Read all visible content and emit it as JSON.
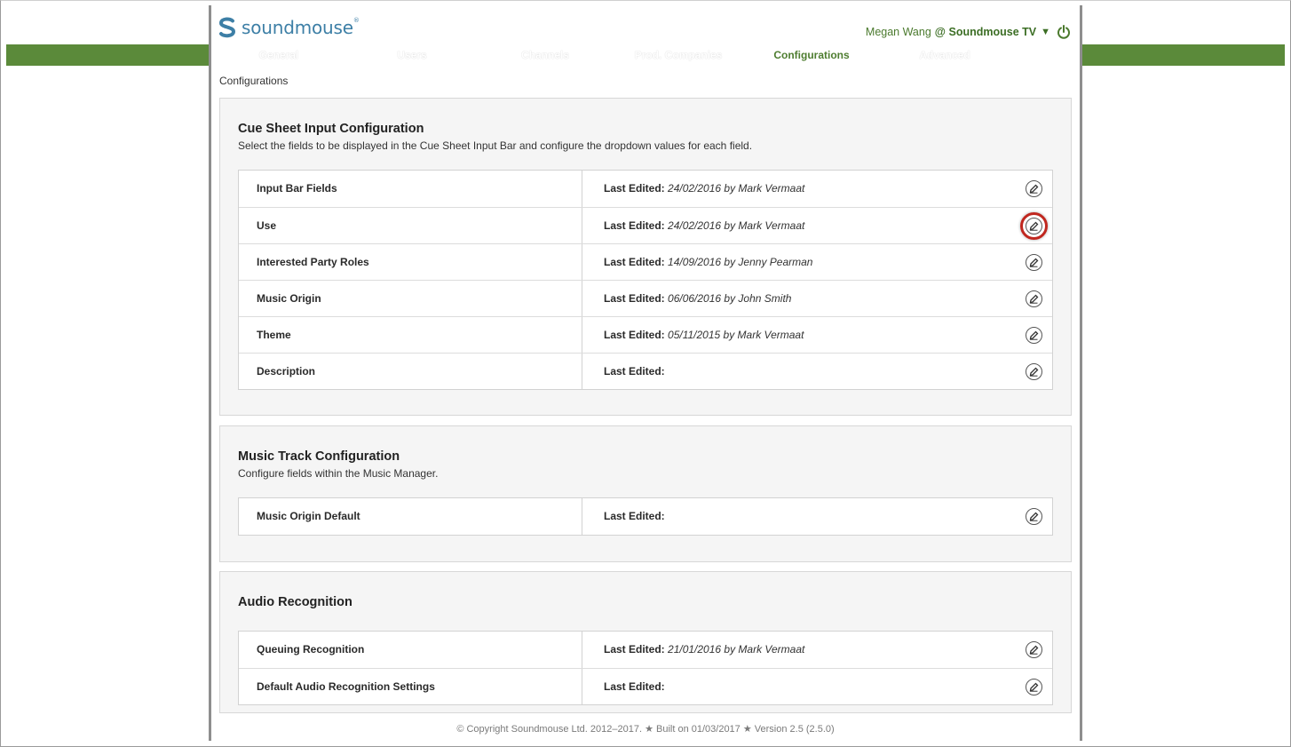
{
  "header": {
    "logo_text": "soundmouse",
    "logo_tm": "®",
    "user_name": "Megan Wang",
    "at": "@",
    "company": "Soundmouse TV",
    "caret": "▼"
  },
  "nav": {
    "tabs": [
      {
        "label": "General",
        "active": false
      },
      {
        "label": "Users",
        "active": false
      },
      {
        "label": "Channels",
        "active": false
      },
      {
        "label": "Prod. Companies",
        "active": false
      },
      {
        "label": "Configurations",
        "active": true
      },
      {
        "label": "Advanced",
        "active": false
      }
    ]
  },
  "breadcrumb": "Configurations",
  "sections": [
    {
      "title": "Cue Sheet Input Configuration",
      "description": "Select the fields to be displayed in the Cue Sheet Input Bar and configure the dropdown values for each field.",
      "rows": [
        {
          "name": "Input Bar Fields",
          "edited_label": "Last Edited:",
          "edited_value": "24/02/2016 by Mark Vermaat"
        },
        {
          "name": "Use",
          "edited_label": "Last Edited:",
          "edited_value": "24/02/2016 by Mark Vermaat"
        },
        {
          "name": "Interested Party Roles",
          "edited_label": "Last Edited:",
          "edited_value": "14/09/2016 by Jenny Pearman"
        },
        {
          "name": "Music Origin",
          "edited_label": "Last Edited:",
          "edited_value": "06/06/2016 by John Smith"
        },
        {
          "name": "Theme",
          "edited_label": "Last Edited:",
          "edited_value": "05/11/2015 by Mark Vermaat"
        },
        {
          "name": "Description",
          "edited_label": "Last Edited:",
          "edited_value": ""
        }
      ]
    },
    {
      "title": "Music Track Configuration",
      "description": "Configure fields within the Music Manager.",
      "rows": [
        {
          "name": "Music Origin Default",
          "edited_label": "Last Edited:",
          "edited_value": ""
        }
      ]
    },
    {
      "title": "Audio Recognition",
      "description": "",
      "rows": [
        {
          "name": "Queuing Recognition",
          "edited_label": "Last Edited:",
          "edited_value": "21/01/2016 by Mark Vermaat"
        },
        {
          "name": "Default Audio Recognition Settings",
          "edited_label": "Last Edited:",
          "edited_value": ""
        }
      ]
    }
  ],
  "footer": "© Copyright Soundmouse Ltd. 2012–2017. ★ Built on 01/03/2017 ★ Version 2.5 (2.5.0)",
  "colors": {
    "nav_green": "#5b8a3a",
    "active_tab_text": "#4e7d30",
    "logo_blue": "#3d7fa6",
    "highlight_red": "#c0271f"
  },
  "icons": {
    "logo": "soundmouse-logo-icon",
    "power": "power-icon",
    "edit": "pencil-edit-icon"
  }
}
